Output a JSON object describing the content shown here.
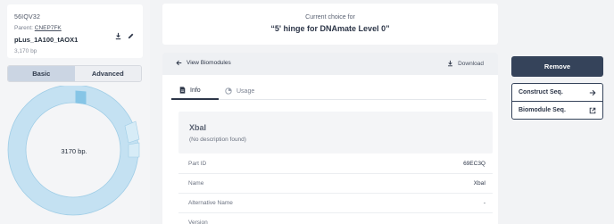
{
  "construct": {
    "id": "56IQV32",
    "parent_label": "Parent: ",
    "parent_id": "CNEP7FK",
    "name": "pLus_1A100_tAOX1",
    "size": "3,170 bp"
  },
  "view_toggle": {
    "basic": "Basic",
    "advanced": "Advanced",
    "selected": "Basic"
  },
  "plasmid": {
    "label": "3170 bp.",
    "ring_color": "#c4e1f2",
    "highlight_color": "#86c5e6"
  },
  "choice": {
    "label": "Current choice for",
    "title": "“5' hinge for DNAmate Level 0”"
  },
  "detail": {
    "back_label": "View Biomodules",
    "download_label": "Download",
    "tabs": [
      {
        "label": "Info",
        "icon": "document-icon",
        "active": true
      },
      {
        "label": "Usage",
        "icon": "pie-chart-icon",
        "active": false
      }
    ],
    "feature": {
      "name": "XbaI",
      "description": "(No description found)"
    },
    "rows": [
      {
        "key": "Part ID",
        "value": "69EC3Q"
      },
      {
        "key": "Name",
        "value": "XbaI"
      },
      {
        "key": "Alternative Name",
        "value": "-"
      },
      {
        "key": "Version",
        "value": ""
      }
    ]
  },
  "actions": {
    "remove": "Remove",
    "construct_seq": "Construct Seq.",
    "biomodule_seq": "Biomodule Seq."
  }
}
